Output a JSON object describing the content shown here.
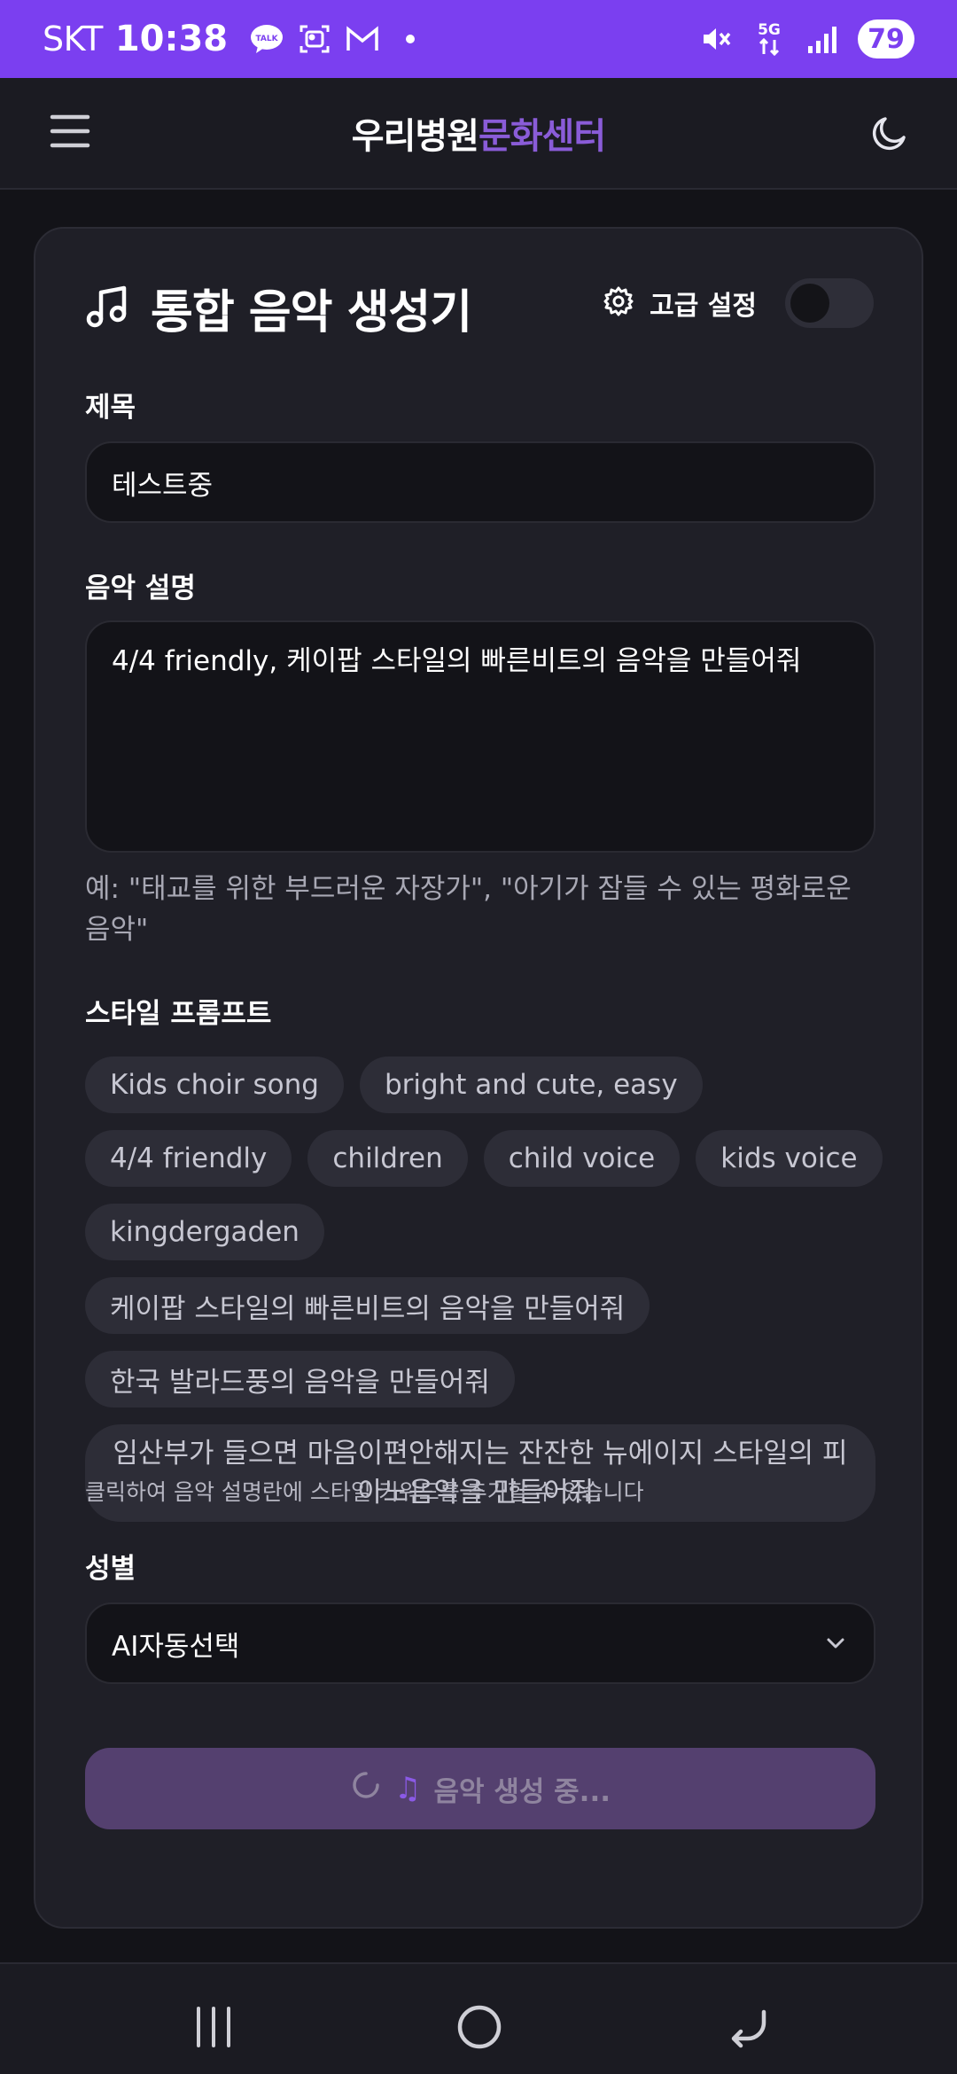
{
  "status_bar": {
    "carrier": "SKT",
    "time": "10:38",
    "battery": "79",
    "network": "5G",
    "left_icons": [
      "talk-icon",
      "gallery-icon",
      "gmail-icon",
      "dot-icon"
    ],
    "right_icons": [
      "mute-icon",
      "5g-icon",
      "signal-icon",
      "battery-icon"
    ],
    "bg_color": "#7b3ff0"
  },
  "header": {
    "brand_part1": "우리병원",
    "brand_part2": "문화센터",
    "brand_accent_color": "#8a5cd8"
  },
  "card": {
    "title": "통합 음악 생성기",
    "advanced_label": "고급 설정",
    "advanced_enabled": false
  },
  "form": {
    "title_label": "제목",
    "title_value": "테스트중",
    "desc_label": "음악 설명",
    "desc_value": "4/4 friendly, 케이팝 스타일의 빠른비트의 음악을 만들어줘",
    "desc_hint": "예: \"태교를 위한 부드러운 자장가\", \"아기가 잠들 수 있는 평화로운 음악\"",
    "style_label": "스타일 프롬프트",
    "style_chips": [
      "Kids choir song",
      "bright and cute, easy",
      "4/4 friendly",
      "children",
      "child voice",
      "kids voice",
      "kingdergaden",
      "케이팝 스타일의 빠른비트의 음악을 만들어줘",
      "한국 발라드풍의 음악을 만들어줘",
      "임산부가 들으면 마음이편안해지는 잔잔한 뉴에이지 스타일의 피아노음악을 만들어줘."
    ],
    "style_hint": "클릭하여 음악 설명란에 스타일 키워드를 추가할 수 있습니다",
    "gender_label": "성별",
    "gender_value": "AI자동선택"
  },
  "generate_button": {
    "label": "음악 생성 중...",
    "state": "loading",
    "color": "#54406f"
  }
}
